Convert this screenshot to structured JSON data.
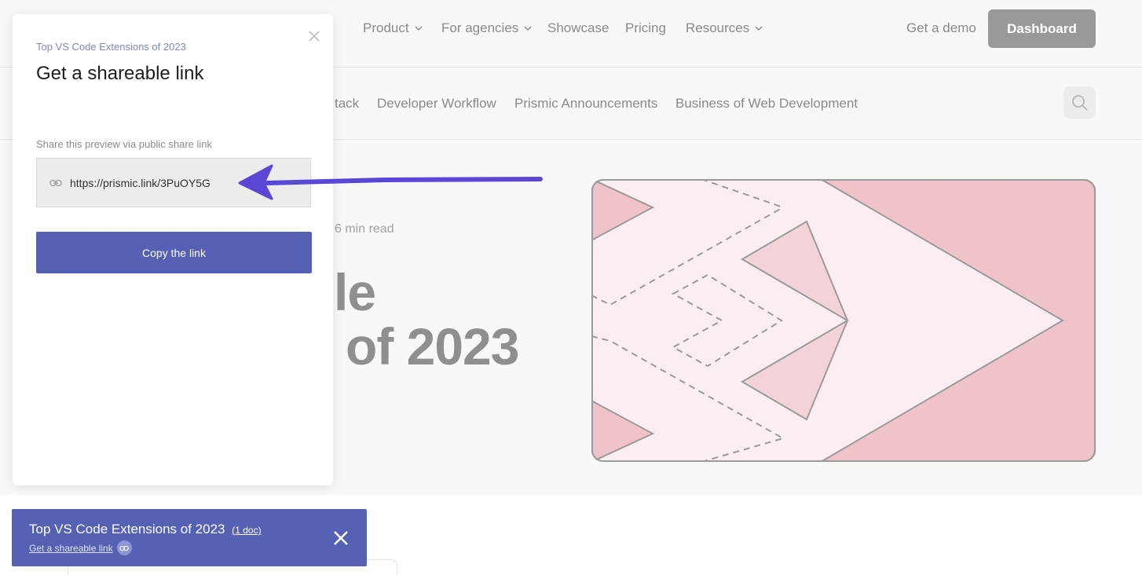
{
  "nav": {
    "items": [
      {
        "label": "Product",
        "has_chevron": true
      },
      {
        "label": "For agencies",
        "has_chevron": true
      },
      {
        "label": "Showcase",
        "has_chevron": false
      },
      {
        "label": "Pricing",
        "has_chevron": false
      },
      {
        "label": "Resources",
        "has_chevron": true
      }
    ],
    "demo_label": "Get a demo",
    "dashboard_label": "Dashboard"
  },
  "subnav": {
    "items": [
      "tack",
      "Developer Workflow",
      "Prismic Announcements",
      "Business of Web Development"
    ],
    "search_icon": "search-icon"
  },
  "article": {
    "meta": "6 min read",
    "title_line1": "le",
    "title_line2": "of 2023"
  },
  "modal": {
    "eyebrow": "Top VS Code Extensions of 2023",
    "title": "Get a shareable link",
    "share_label": "Share this preview via public share link",
    "link": "https://prismic.link/3PuOY5G",
    "copy_button": "Copy the link",
    "close_icon": "close-icon",
    "link_icon": "link-icon"
  },
  "toolbar": {
    "title": "Top VS Code Extensions of 2023",
    "doc_count": "(1 doc)",
    "share_link_label": "Get a shareable link",
    "close_icon": "close-icon"
  },
  "colors": {
    "accent": "#5562b3",
    "arrow": "#5b47d6",
    "illustration_pink": "#f0c3ca",
    "illustration_light": "#fbeef0"
  }
}
